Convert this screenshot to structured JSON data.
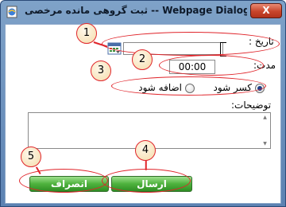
{
  "window": {
    "title": "ثبت گروهی مانده مرخصی -- Webpage Dialog",
    "close_label": "X"
  },
  "form": {
    "date_label": "تاریخ :",
    "date_value": "",
    "calendar_icon": "calendar-icon",
    "duration_label": "مدت:",
    "duration_value": "00:00",
    "radio_deduct_label": "کسر شود",
    "radio_add_label": "اضافه شود",
    "selected_option": "کسر شود",
    "notes_label": "توضیحات:",
    "notes_value": ""
  },
  "buttons": {
    "send_label": "ارسال",
    "cancel_label": "انصراف"
  },
  "annotations": {
    "badge_1": "1",
    "badge_2": "2",
    "badge_3": "3",
    "badge_4": "4",
    "badge_5": "5",
    "color": "#e0252b"
  },
  "colors": {
    "title_bar": "#6d90bd",
    "close_button": "#c8452b",
    "action_button": "#4eb23d"
  }
}
